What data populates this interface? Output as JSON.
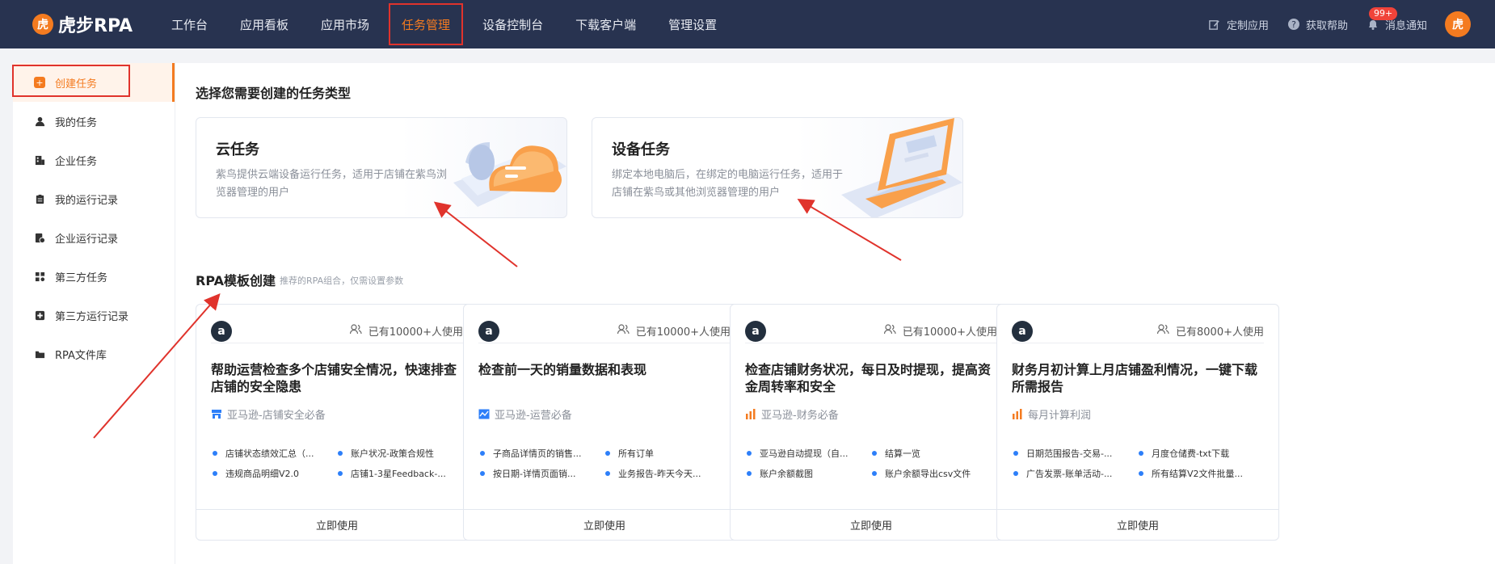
{
  "app": {
    "logo_text": "虎步RPA",
    "brand_color": "#f47b20",
    "nav_bg": "#283350"
  },
  "nav": {
    "items": [
      {
        "label": "工作台"
      },
      {
        "label": "应用看板"
      },
      {
        "label": "应用市场"
      },
      {
        "label": "任务管理",
        "active": true
      },
      {
        "label": "设备控制台"
      },
      {
        "label": "下载客户端"
      },
      {
        "label": "管理设置"
      }
    ]
  },
  "top_right": {
    "custom_app": "定制应用",
    "help": "获取帮助",
    "notify": "消息通知",
    "notify_badge": "99+"
  },
  "sidebar": {
    "items": [
      {
        "label": "创建任务",
        "icon": "plus-square-icon",
        "active": true
      },
      {
        "label": "我的任务",
        "icon": "user-icon"
      },
      {
        "label": "企业任务",
        "icon": "building-icon"
      },
      {
        "label": "我的运行记录",
        "icon": "clipboard-icon"
      },
      {
        "label": "企业运行记录",
        "icon": "file-clock-icon"
      },
      {
        "label": "第三方任务",
        "icon": "apps-icon"
      },
      {
        "label": "第三方运行记录",
        "icon": "plus-box-icon"
      },
      {
        "label": "RPA文件库",
        "icon": "folder-icon"
      }
    ]
  },
  "main": {
    "section_title": "选择您需要创建的任务类型",
    "task_types": [
      {
        "title": "云任务",
        "desc": "紫鸟提供云端设备运行任务，适用于店铺在紫鸟浏览器管理的用户"
      },
      {
        "title": "设备任务",
        "desc": "绑定本地电脑后，在绑定的电脑运行任务，适用于店铺在紫鸟或其他浏览器管理的用户"
      }
    ],
    "rpa_title": "RPA模板创建",
    "rpa_sub": "推荐的RPA组合，仅需设置参数",
    "templates": [
      {
        "users": "已有10000+人使用",
        "title": "帮助运营检查多个店铺安全情况，快速排查店铺的安全隐患",
        "category": "亚马逊-店铺安全必备",
        "cat_color": "#2d7ff9",
        "items": [
          "店铺状态绩效汇总（...",
          "账户状况-政策合规性",
          "违规商品明细V2.0",
          "店铺1-3星Feedback-..."
        ],
        "button": "立即使用"
      },
      {
        "users": "已有10000+人使用",
        "title": "检查前一天的销量数据和表现",
        "category": "亚马逊-运营必备",
        "cat_color": "#2d7ff9",
        "items": [
          "子商品详情页的销售...",
          "所有订单",
          "按日期-详情页面销...",
          "业务报告-昨天今天..."
        ],
        "button": "立即使用"
      },
      {
        "users": "已有10000+人使用",
        "title": "检查店铺财务状况，每日及时提现，提高资金周转率和安全",
        "category": "亚马逊-财务必备",
        "cat_color": "#f47b20",
        "items": [
          "亚马逊自动提现（自...",
          "结算一览",
          "账户余额截图",
          "账户余额导出csv文件"
        ],
        "button": "立即使用"
      },
      {
        "users": "已有8000+人使用",
        "title": "财务月初计算上月店铺盈利情况，一键下载所需报告",
        "category": "每月计算利润",
        "cat_color": "#f47b20",
        "items": [
          "日期范围报告-交易-...",
          "月度仓储费-txt下载",
          "广告发票-账单活动-...",
          "所有结算V2文件批量..."
        ],
        "button": "立即使用"
      }
    ]
  }
}
